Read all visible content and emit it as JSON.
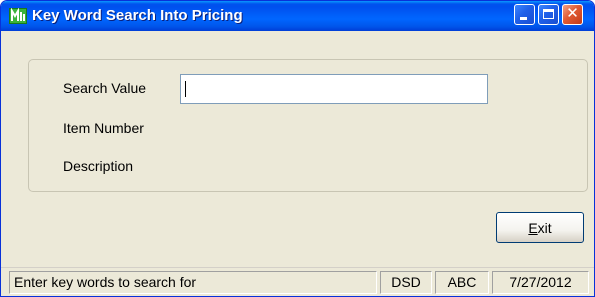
{
  "window": {
    "title": "Key Word Search Into Pricing",
    "app_icon": "accounting-app-icon",
    "controls": {
      "minimize_icon": "minimize-icon",
      "maximize_icon": "maximize-icon",
      "close_icon": "close-icon",
      "close_glyph": "✕"
    }
  },
  "form": {
    "search_value_label": "Search Value",
    "search_value": "",
    "item_number_label": "Item Number",
    "description_label": "Description"
  },
  "buttons": {
    "exit_accel": "E",
    "exit_rest": "xit"
  },
  "statusbar": {
    "message": "Enter key words to search for",
    "company": "DSD",
    "user": "ABC",
    "date": "7/27/2012"
  },
  "colors": {
    "titlebar": "#0055ea",
    "window_face": "#ece9d8",
    "close_button": "#e05a33"
  }
}
